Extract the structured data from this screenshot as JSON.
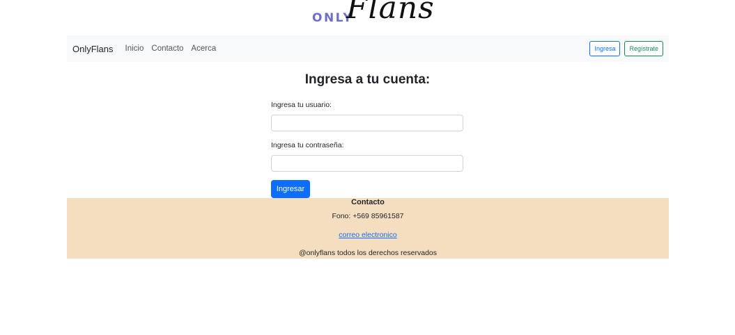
{
  "logo": {
    "prefix": "ONLY",
    "main": "Flans"
  },
  "navbar": {
    "brand": "OnlyFlans",
    "links": [
      "Inicio",
      "Contacto",
      "Acerca"
    ],
    "login_button": "Ingresa",
    "register_button": "Regístrate"
  },
  "form": {
    "title": "Ingresa a tu cuenta:",
    "username_label": "Ingresa tu usuario:",
    "username_value": "",
    "password_label": "Ingresa tu contraseña:",
    "password_value": "",
    "submit_label": "Ingresar"
  },
  "footer": {
    "title": "Contacto",
    "phone": "Fono: +569 85961587",
    "email_link": "correo electronico",
    "copyright": "@onlyflans todos los derechos reservados"
  },
  "colors": {
    "primary": "#0d6efd",
    "success": "#198754",
    "navbar_bg": "#f8f9fa",
    "footer_bg": "#f5dec0",
    "logo_accent": "#6f6fc9"
  }
}
